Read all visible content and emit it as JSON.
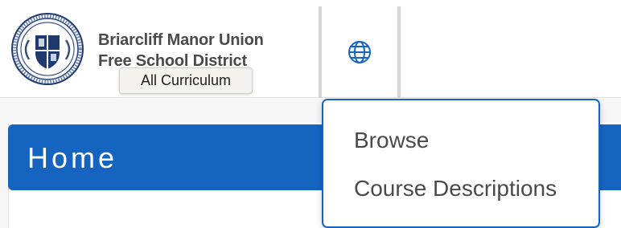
{
  "header": {
    "district_name_line1": "Briarcliff Manor Union",
    "district_name_line2": "Free School District",
    "tooltip": "All Curriculum",
    "language_icon": "globe-icon"
  },
  "main": {
    "page_title": "Home"
  },
  "dropdown": {
    "items": [
      {
        "label": "Browse"
      },
      {
        "label": "Course Descriptions"
      }
    ]
  },
  "colors": {
    "accent": "#1565c0",
    "header_text": "#4a4a4a",
    "divider": "#d6d6d6"
  }
}
